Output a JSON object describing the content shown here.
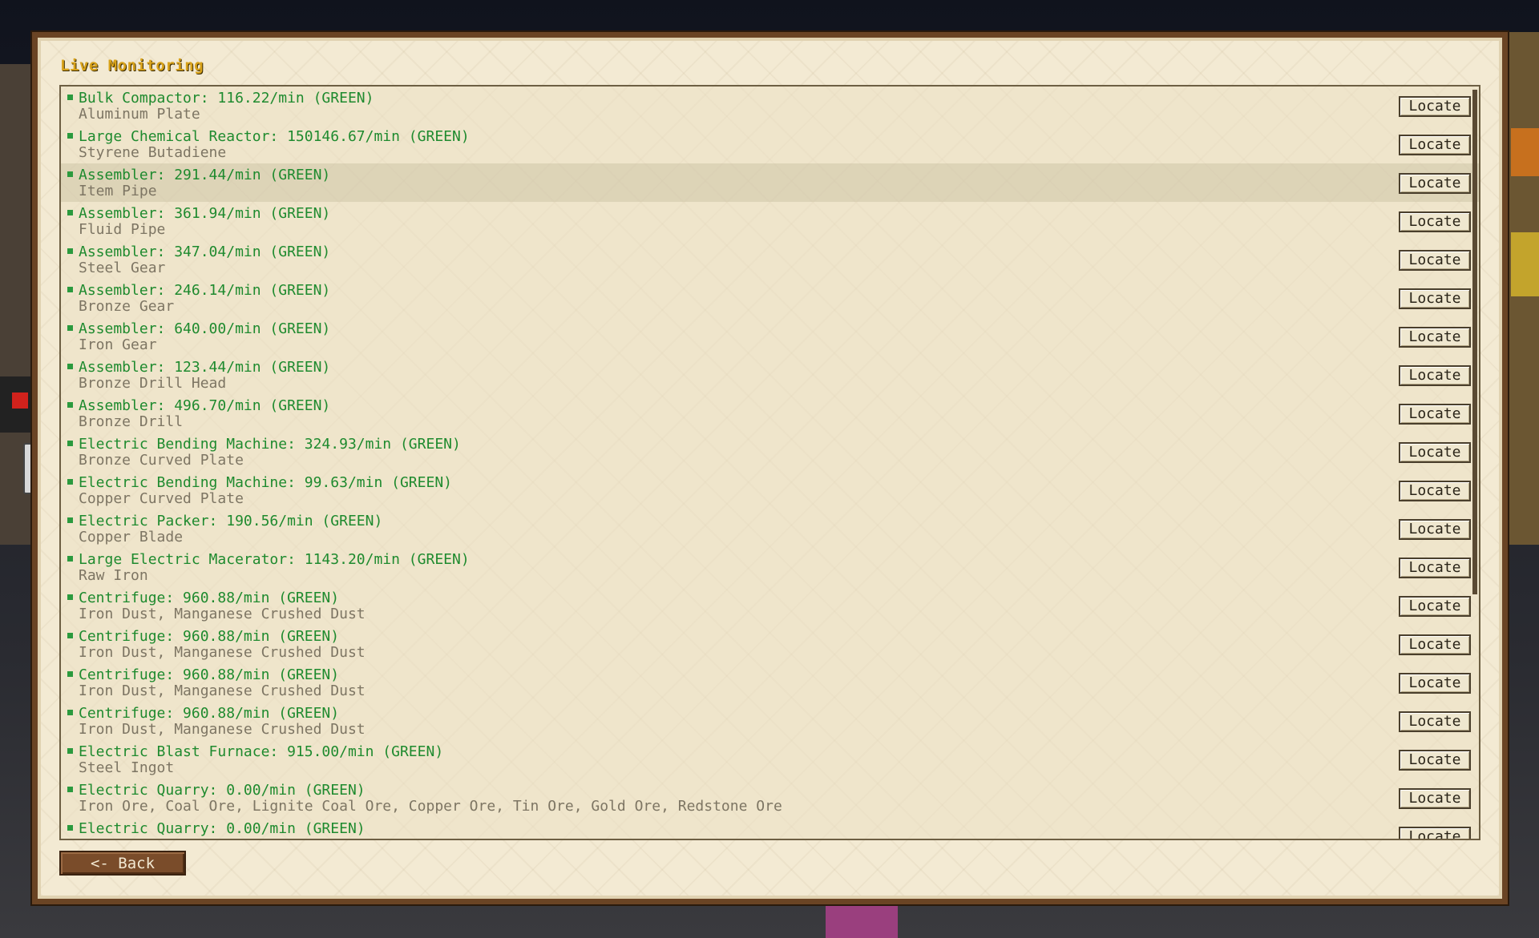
{
  "window": {
    "title": "Live Monitoring"
  },
  "rows": [
    {
      "line1": "Bulk Compactor: 116.22/min (GREEN)",
      "line2": "Aluminum Plate",
      "button": "Locate"
    },
    {
      "line1": "Large Chemical Reactor: 150146.67/min (GREEN)",
      "line2": "Styrene Butadiene",
      "button": "Locate"
    },
    {
      "line1": "Assembler: 291.44/min (GREEN)",
      "line2": "Item Pipe",
      "button": "Locate"
    },
    {
      "line1": "Assembler: 361.94/min (GREEN)",
      "line2": "Fluid Pipe",
      "button": "Locate"
    },
    {
      "line1": "Assembler: 347.04/min (GREEN)",
      "line2": "Steel Gear",
      "button": "Locate"
    },
    {
      "line1": "Assembler: 246.14/min (GREEN)",
      "line2": "Bronze Gear",
      "button": "Locate"
    },
    {
      "line1": "Assembler: 640.00/min (GREEN)",
      "line2": "Iron Gear",
      "button": "Locate"
    },
    {
      "line1": "Assembler: 123.44/min (GREEN)",
      "line2": "Bronze Drill Head",
      "button": "Locate"
    },
    {
      "line1": "Assembler: 496.70/min (GREEN)",
      "line2": "Bronze Drill",
      "button": "Locate"
    },
    {
      "line1": "Electric Bending Machine: 324.93/min (GREEN)",
      "line2": "Bronze Curved Plate",
      "button": "Locate"
    },
    {
      "line1": "Electric Bending Machine: 99.63/min (GREEN)",
      "line2": "Copper Curved Plate",
      "button": "Locate"
    },
    {
      "line1": "Electric Packer: 190.56/min (GREEN)",
      "line2": "Copper Blade",
      "button": "Locate"
    },
    {
      "line1": "Large Electric Macerator: 1143.20/min (GREEN)",
      "line2": "Raw Iron",
      "button": "Locate"
    },
    {
      "line1": "Centrifuge: 960.88/min (GREEN)",
      "line2": "Iron Dust, Manganese Crushed Dust",
      "button": "Locate"
    },
    {
      "line1": "Centrifuge: 960.88/min (GREEN)",
      "line2": "Iron Dust, Manganese Crushed Dust",
      "button": "Locate"
    },
    {
      "line1": "Centrifuge: 960.88/min (GREEN)",
      "line2": "Iron Dust, Manganese Crushed Dust",
      "button": "Locate"
    },
    {
      "line1": "Centrifuge: 960.88/min (GREEN)",
      "line2": "Iron Dust, Manganese Crushed Dust",
      "button": "Locate"
    },
    {
      "line1": "Electric Blast Furnace: 915.00/min (GREEN)",
      "line2": "Steel Ingot",
      "button": "Locate"
    },
    {
      "line1": "Electric Quarry: 0.00/min (GREEN)",
      "line2": "Iron Ore, Coal Ore, Lignite Coal Ore, Copper Ore, Tin Ore, Gold Ore, Redstone Ore",
      "button": "Locate"
    },
    {
      "line1": "Electric Quarry: 0.00/min (GREEN)",
      "line2": "",
      "button": "Locate"
    }
  ],
  "footer": {
    "back_label": "<- Back"
  },
  "colors": {
    "status_green": "#1e8a2e",
    "panel_border": "#6a4424",
    "title": "#d8a21a"
  }
}
